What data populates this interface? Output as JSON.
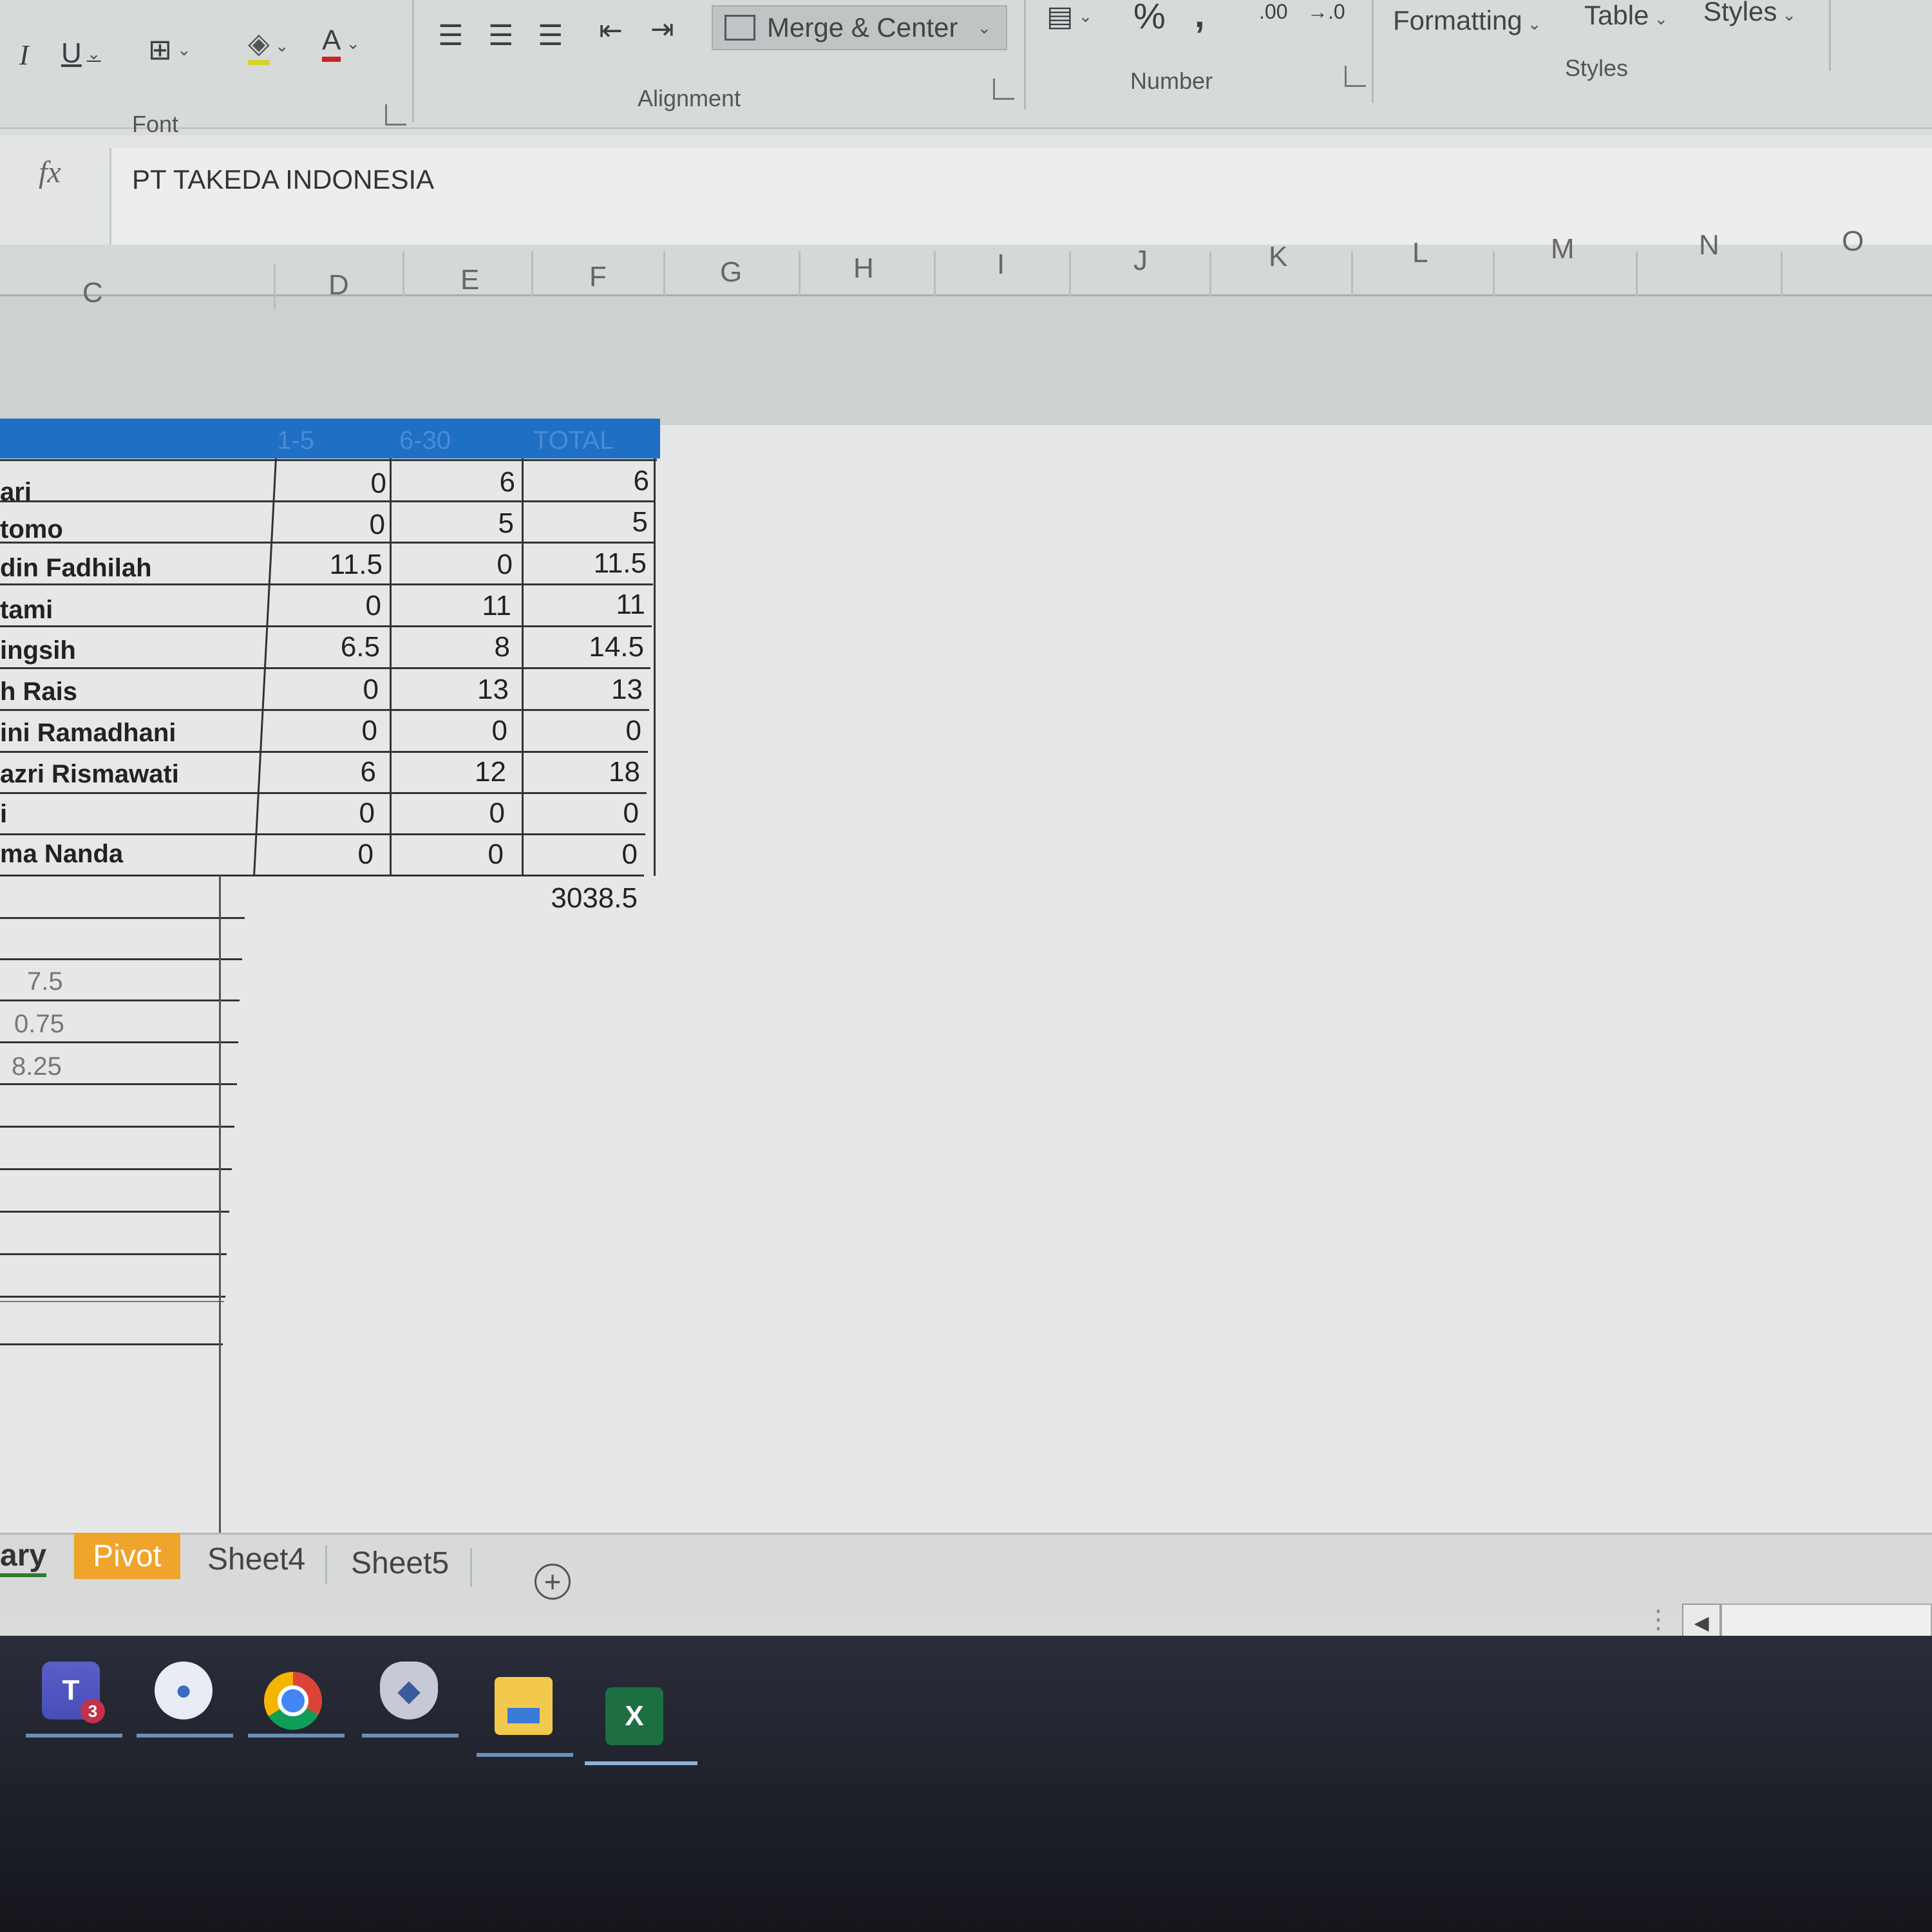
{
  "ribbon": {
    "merge_label": "Merge & Center",
    "formatting_label": "Formatting",
    "table_label": "Table",
    "styles_label": "Styles",
    "groups": {
      "font": "Font",
      "alignment": "Alignment",
      "number": "Number",
      "styles": "Styles"
    }
  },
  "formula_bar": {
    "fx": "fx",
    "value": "PT TAKEDA INDONESIA"
  },
  "columns": [
    "C",
    "D",
    "E",
    "F",
    "G",
    "H",
    "I",
    "J",
    "K",
    "L",
    "M",
    "N",
    "O"
  ],
  "table": {
    "headers": [
      "1-5",
      "6-30",
      "TOTAL"
    ],
    "rows": [
      {
        "name": "ari",
        "d": "0",
        "e": "6",
        "f": "6"
      },
      {
        "name": "tomo",
        "d": "0",
        "e": "5",
        "f": "5"
      },
      {
        "name": "din Fadhilah",
        "d": "11.5",
        "e": "0",
        "f": "11.5"
      },
      {
        "name": "tami",
        "d": "0",
        "e": "11",
        "f": "11"
      },
      {
        "name": "ingsih",
        "d": "6.5",
        "e": "8",
        "f": "14.5"
      },
      {
        "name": "h Rais",
        "d": "0",
        "e": "13",
        "f": "13"
      },
      {
        "name": "ini Ramadhani",
        "d": "0",
        "e": "0",
        "f": "0"
      },
      {
        "name": "azri Rismawati",
        "d": "6",
        "e": "12",
        "f": "18"
      },
      {
        "name": "i",
        "d": "0",
        "e": "0",
        "f": "0"
      },
      {
        "name": "ma Nanda",
        "d": "0",
        "e": "0",
        "f": "0"
      }
    ],
    "grand_total": "3038.5"
  },
  "side_values": [
    "7.5",
    "0.75",
    "8.25"
  ],
  "sheet_tabs": {
    "summary": "ary",
    "pivot": "Pivot",
    "sheet4": "Sheet4",
    "sheet5": "Sheet5",
    "add": "+"
  },
  "taskbar": {
    "teams_badge": "3",
    "excel_label": "X"
  },
  "colors": {
    "header_blue": "#1f6fc5",
    "pivot_tab": "#f0a42c"
  }
}
